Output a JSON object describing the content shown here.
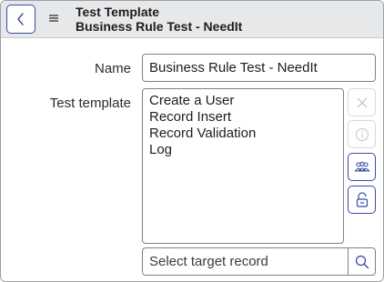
{
  "header": {
    "title": "Test Template",
    "subtitle": "Business Rule Test - NeedIt",
    "back_icon": "chevron-left-icon",
    "menu_icon": "hamburger-menu-icon"
  },
  "form": {
    "name_label": "Name",
    "name_value": "Business Rule Test - NeedIt",
    "template_label": "Test template",
    "template_lines": [
      "Create a User",
      "Record Insert",
      "Record Validation",
      "Log"
    ],
    "side_buttons": [
      {
        "icon": "close-icon",
        "enabled": false
      },
      {
        "icon": "info-icon",
        "enabled": false
      },
      {
        "icon": "users-group-icon",
        "enabled": true
      },
      {
        "icon": "unlock-icon",
        "enabled": true
      }
    ],
    "search_placeholder": "Select target record",
    "search_icon": "search-icon"
  },
  "colors": {
    "accent": "#3b4aa8",
    "header_bg": "#e6e8ea",
    "disabled": "#c8ccd1"
  }
}
